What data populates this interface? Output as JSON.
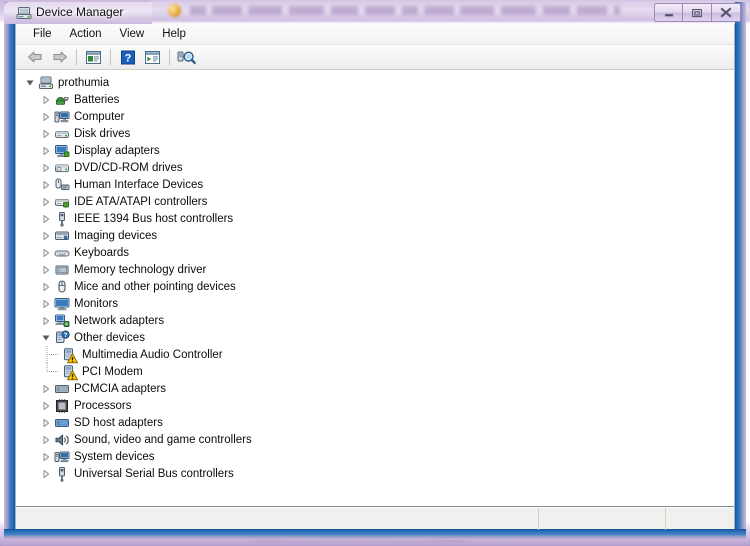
{
  "window": {
    "title": "Device Manager",
    "icon": "device-manager-icon",
    "controls": {
      "minimize": "Minimize",
      "restore": "Restore",
      "close": "Close"
    }
  },
  "background": {
    "description": "blurred browser window behind",
    "url_blurred": true
  },
  "menubar": {
    "items": [
      {
        "label": "File"
      },
      {
        "label": "Action"
      },
      {
        "label": "View"
      },
      {
        "label": "Help"
      }
    ]
  },
  "toolbar": {
    "buttons": [
      {
        "name": "back-button",
        "icon": "back-arrow-icon",
        "label": "Back"
      },
      {
        "name": "forward-button",
        "icon": "forward-arrow-icon",
        "label": "Forward"
      },
      {
        "name": "separator-1",
        "icon": "separator",
        "label": ""
      },
      {
        "name": "properties-button",
        "icon": "properties-icon",
        "label": "Properties"
      },
      {
        "name": "separator-2",
        "icon": "separator",
        "label": ""
      },
      {
        "name": "help-button",
        "icon": "help-question-icon",
        "label": "Help"
      },
      {
        "name": "show-hide-console-tree-button",
        "icon": "console-tree-icon",
        "label": "Show/Hide Console Tree"
      },
      {
        "name": "separator-3",
        "icon": "separator",
        "label": ""
      },
      {
        "name": "scan-hardware-changes-button",
        "icon": "scan-hardware-icon",
        "label": "Scan for hardware changes"
      }
    ]
  },
  "tree": {
    "root": {
      "label": "prothumia",
      "icon": "computer-node-icon",
      "expanded": true
    },
    "nodes": [
      {
        "label": "Batteries",
        "icon": "batteries-icon",
        "level": 1,
        "expanded": false,
        "warning": false
      },
      {
        "label": "Computer",
        "icon": "computer-icon",
        "level": 1,
        "expanded": false,
        "warning": false
      },
      {
        "label": "Disk drives",
        "icon": "disk-drive-icon",
        "level": 1,
        "expanded": false,
        "warning": false
      },
      {
        "label": "Display adapters",
        "icon": "display-adapter-icon",
        "level": 1,
        "expanded": false,
        "warning": false
      },
      {
        "label": "DVD/CD-ROM drives",
        "icon": "dvd-cdrom-icon",
        "level": 1,
        "expanded": false,
        "warning": false
      },
      {
        "label": "Human Interface Devices",
        "icon": "hid-icon",
        "level": 1,
        "expanded": false,
        "warning": false
      },
      {
        "label": "IDE ATA/ATAPI controllers",
        "icon": "ide-controller-icon",
        "level": 1,
        "expanded": false,
        "warning": false
      },
      {
        "label": "IEEE 1394 Bus host controllers",
        "icon": "ieee1394-icon",
        "level": 1,
        "expanded": false,
        "warning": false
      },
      {
        "label": "Imaging devices",
        "icon": "imaging-device-icon",
        "level": 1,
        "expanded": false,
        "warning": false
      },
      {
        "label": "Keyboards",
        "icon": "keyboard-icon",
        "level": 1,
        "expanded": false,
        "warning": false
      },
      {
        "label": "Memory technology driver",
        "icon": "memory-technology-icon",
        "level": 1,
        "expanded": false,
        "warning": false
      },
      {
        "label": "Mice and other pointing devices",
        "icon": "mouse-icon",
        "level": 1,
        "expanded": false,
        "warning": false
      },
      {
        "label": "Monitors",
        "icon": "monitor-icon",
        "level": 1,
        "expanded": false,
        "warning": false
      },
      {
        "label": "Network adapters",
        "icon": "network-adapter-icon",
        "level": 1,
        "expanded": false,
        "warning": false
      },
      {
        "label": "Other devices",
        "icon": "other-devices-icon",
        "level": 1,
        "expanded": true,
        "warning": false
      },
      {
        "label": "Multimedia Audio Controller",
        "icon": "unknown-device-icon",
        "level": 2,
        "expanded": null,
        "warning": true
      },
      {
        "label": "PCI Modem",
        "icon": "unknown-device-icon",
        "level": 2,
        "expanded": null,
        "warning": true
      },
      {
        "label": "PCMCIA adapters",
        "icon": "pcmcia-adapter-icon",
        "level": 1,
        "expanded": false,
        "warning": false
      },
      {
        "label": "Processors",
        "icon": "processor-icon",
        "level": 1,
        "expanded": false,
        "warning": false
      },
      {
        "label": "SD host adapters",
        "icon": "sd-host-adapter-icon",
        "level": 1,
        "expanded": false,
        "warning": false
      },
      {
        "label": "Sound, video and game controllers",
        "icon": "sound-video-game-icon",
        "level": 1,
        "expanded": false,
        "warning": false
      },
      {
        "label": "System devices",
        "icon": "system-device-icon",
        "level": 1,
        "expanded": false,
        "warning": false
      },
      {
        "label": "Universal Serial Bus controllers",
        "icon": "usb-controller-icon",
        "level": 1,
        "expanded": false,
        "warning": false
      }
    ]
  },
  "statusbar": {
    "panes": [
      "",
      "",
      ""
    ]
  },
  "colors": {
    "frame_blue": "#2f72bd",
    "title_glass": "#e4dcee",
    "client_bg": "#f0f0f0",
    "tree_bg": "#ffffff",
    "warning_yellow": "#ffcc00",
    "text": "#0c0c0c"
  }
}
